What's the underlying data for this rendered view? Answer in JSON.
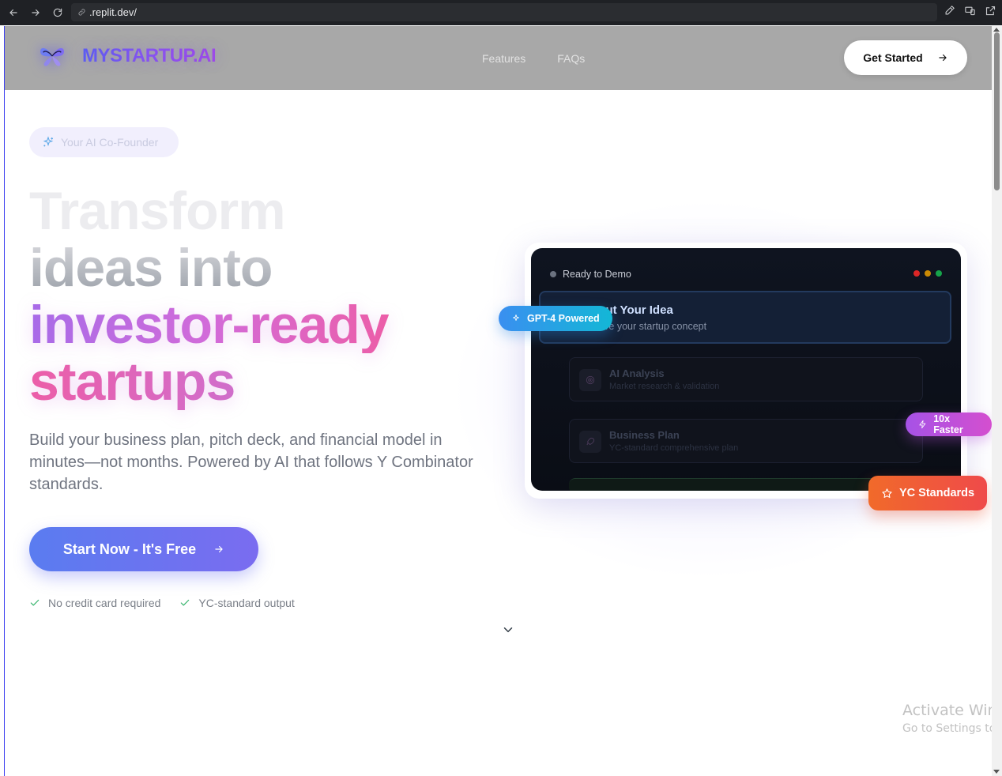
{
  "browser": {
    "url": ".replit.dev/"
  },
  "header": {
    "brand": "MYSTARTUP.AI",
    "nav": [
      "Features",
      "FAQs"
    ],
    "cta_label": "Get Started"
  },
  "hero": {
    "badge": "Your AI Co-Founder",
    "headline": [
      "Transform",
      "ideas into",
      "investor-ready",
      "startups"
    ],
    "subtext": "Build your business plan, pitch deck, and financial model in minutes—not months. Powered by AI that follows Y Combinator standards.",
    "cta_label": "Start Now - It's Free",
    "checks": [
      "No credit card required",
      "YC-standard output"
    ]
  },
  "demo": {
    "status": "Ready to Demo",
    "traffic_colors": [
      "#dc2626",
      "#ca8a04",
      "#16a34a"
    ],
    "steps": [
      {
        "title": "Input Your Idea",
        "subtitle": "Share your startup concept"
      },
      {
        "title": "AI Analysis",
        "subtitle": "Market research & validation"
      },
      {
        "title": "Business Plan",
        "subtitle": "YC-standard comprehensive plan"
      }
    ],
    "pills": {
      "gpt": "GPT-4 Powered",
      "faster": "10x Faster",
      "yc": "YC Standards"
    }
  },
  "watermark": {
    "line1": "Activate Windows",
    "line2": "Go to Settings to activate Windows."
  }
}
